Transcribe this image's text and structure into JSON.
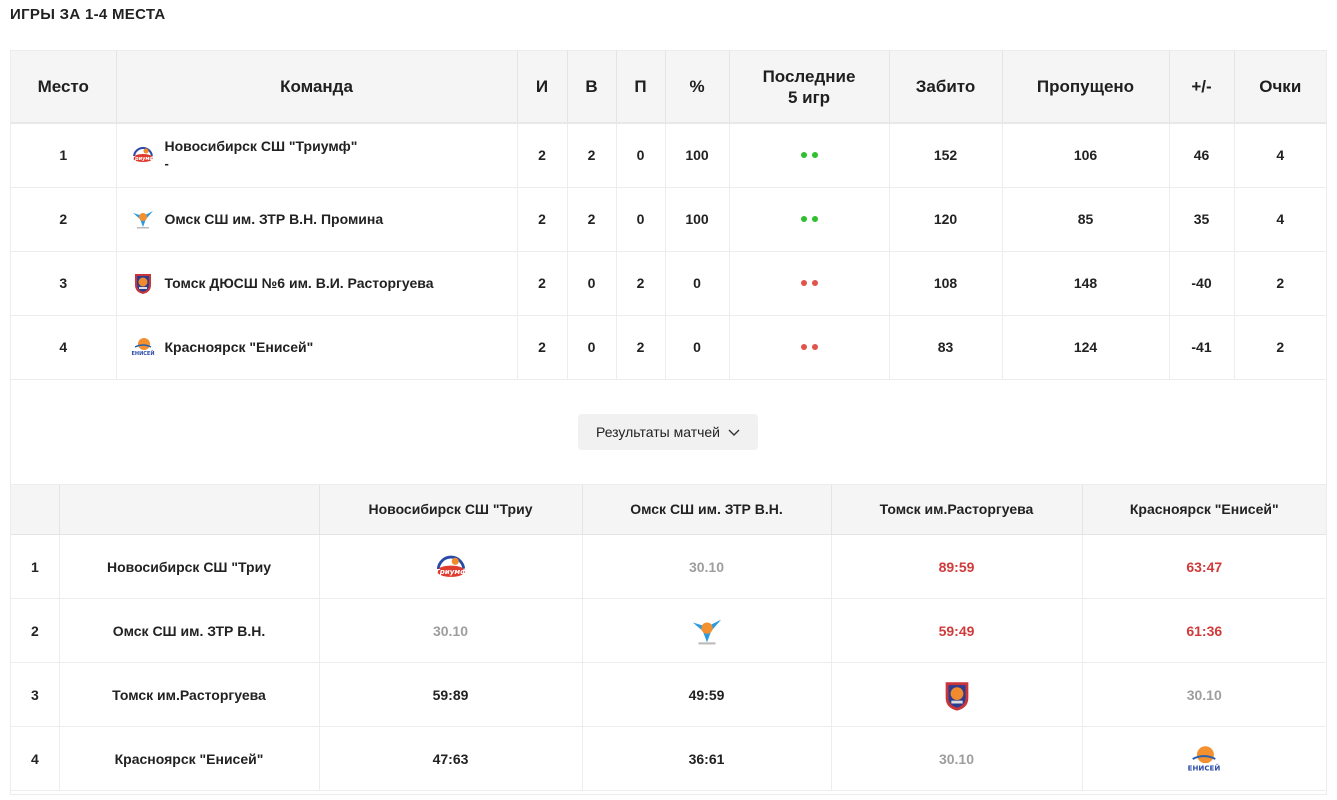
{
  "page": {
    "title": "ИГРЫ ЗА 1-4 МЕСТА"
  },
  "colors": {
    "win_dot": "#2fbf2f",
    "loss_dot": "#e0554a",
    "score_win": "#d03a3a",
    "score_date": "#9e9e9e"
  },
  "standings": {
    "headers": {
      "place": "Место",
      "team": "Команда",
      "games": "И",
      "wins": "В",
      "losses": "П",
      "pct": "%",
      "last5_line1": "Последние",
      "last5_line2": "5 игр",
      "scored": "Забито",
      "conceded": "Пропущено",
      "diff": "+/-",
      "points": "Очки"
    },
    "rows": [
      {
        "place": "1",
        "team": "Новосибирск СШ \"Триумф\"",
        "team_sub": "-",
        "logo": "triumf-logo",
        "games": "2",
        "wins": "2",
        "losses": "0",
        "pct": "100",
        "last5": [
          "win",
          "win"
        ],
        "scored": "152",
        "conceded": "106",
        "diff": "46",
        "points": "4"
      },
      {
        "place": "2",
        "team": "Омск СШ им. ЗТР В.Н. Промина",
        "team_sub": "",
        "logo": "omsk-logo",
        "games": "2",
        "wins": "2",
        "losses": "0",
        "pct": "100",
        "last5": [
          "win",
          "win"
        ],
        "scored": "120",
        "conceded": "85",
        "diff": "35",
        "points": "4"
      },
      {
        "place": "3",
        "team": "Томск ДЮСШ №6 им. В.И. Расторгуева",
        "team_sub": "",
        "logo": "tomsk-logo",
        "games": "2",
        "wins": "0",
        "losses": "2",
        "pct": "0",
        "last5": [
          "loss",
          "loss"
        ],
        "scored": "108",
        "conceded": "148",
        "diff": "-40",
        "points": "2"
      },
      {
        "place": "4",
        "team": "Красноярск \"Енисей\"",
        "team_sub": "",
        "logo": "enisey-logo",
        "games": "2",
        "wins": "0",
        "losses": "2",
        "pct": "0",
        "last5": [
          "loss",
          "loss"
        ],
        "scored": "83",
        "conceded": "124",
        "diff": "-41",
        "points": "2"
      }
    ]
  },
  "results_button": {
    "label": "Результаты матчей",
    "icon": "chevron-down-icon"
  },
  "matrix": {
    "headers": [
      "Новосибирск СШ \"Триу",
      "Омск СШ им. ЗТР В.Н.",
      "Томск им.Расторгуева",
      "Красноярск \"Енисей\""
    ],
    "rows": [
      {
        "rank": "1",
        "team": "Новосибирск СШ \"Триу",
        "cells": [
          {
            "type": "logo",
            "logo": "triumf-logo"
          },
          {
            "type": "date",
            "text": "30.10"
          },
          {
            "type": "win",
            "text": "89:59"
          },
          {
            "type": "win",
            "text": "63:47"
          }
        ]
      },
      {
        "rank": "2",
        "team": "Омск СШ им. ЗТР В.Н.",
        "cells": [
          {
            "type": "date",
            "text": "30.10"
          },
          {
            "type": "logo",
            "logo": "omsk-logo"
          },
          {
            "type": "win",
            "text": "59:49"
          },
          {
            "type": "win",
            "text": "61:36"
          }
        ]
      },
      {
        "rank": "3",
        "team": "Томск им.Расторгуева",
        "cells": [
          {
            "type": "loss",
            "text": "59:89"
          },
          {
            "type": "loss",
            "text": "49:59"
          },
          {
            "type": "logo",
            "logo": "tomsk-logo"
          },
          {
            "type": "date",
            "text": "30.10"
          }
        ]
      },
      {
        "rank": "4",
        "team": "Красноярск \"Енисей\"",
        "cells": [
          {
            "type": "loss",
            "text": "47:63"
          },
          {
            "type": "loss",
            "text": "36:61"
          },
          {
            "type": "date",
            "text": "30.10"
          },
          {
            "type": "logo",
            "logo": "enisey-logo"
          }
        ]
      }
    ]
  }
}
